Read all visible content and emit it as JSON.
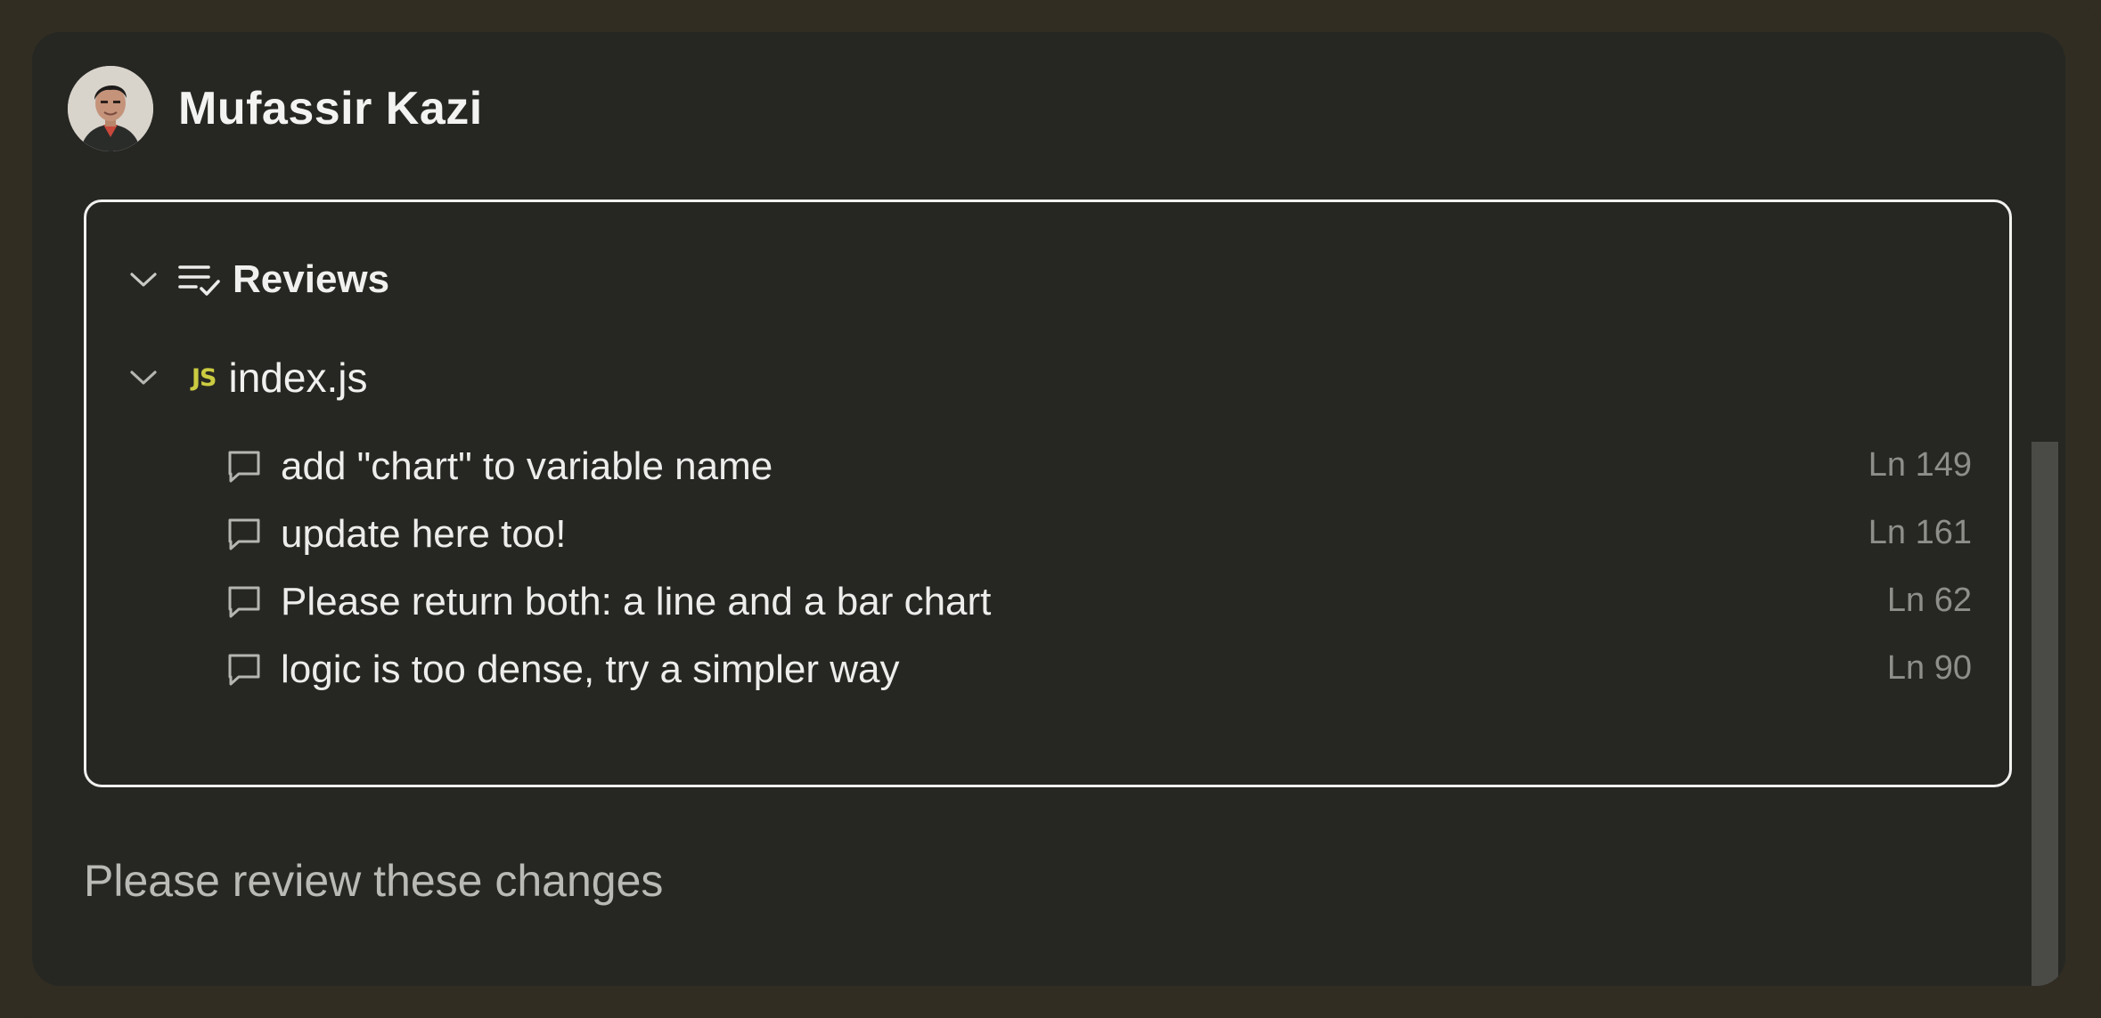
{
  "header": {
    "user_name": "Mufassir Kazi",
    "avatar_icon": "user-avatar"
  },
  "reviews": {
    "title": "Reviews",
    "icon": "list-check-icon",
    "file": {
      "badge": "JS",
      "name": "index.js",
      "badge_color": "#cbcb41"
    },
    "comments": [
      {
        "text": "add \"chart\" to variable name",
        "line": "Ln 149"
      },
      {
        "text": "update here too!",
        "line": "Ln 161"
      },
      {
        "text": "Please return both: a line and a bar chart",
        "line": "Ln 62"
      },
      {
        "text": "logic is too dense, try a simpler way",
        "line": "Ln 90"
      }
    ]
  },
  "message": "Please review these changes",
  "colors": {
    "outer_bg": "#312d22",
    "panel_bg": "#262723",
    "border": "#f1f1ef"
  }
}
